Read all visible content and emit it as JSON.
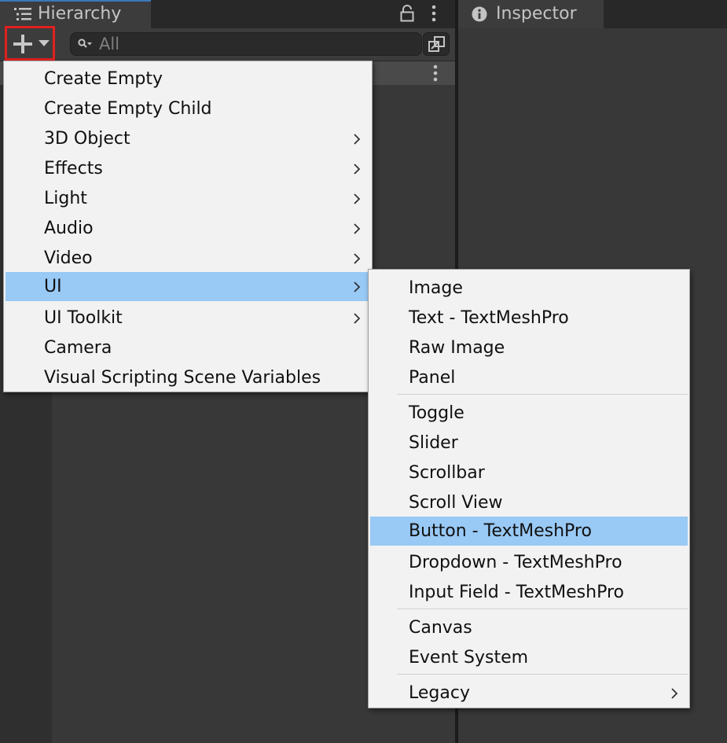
{
  "hierarchy": {
    "tab_label": "Hierarchy",
    "search_placeholder": "All"
  },
  "inspector": {
    "tab_label": "Inspector"
  },
  "create_menu": {
    "items": [
      {
        "label": "Create Empty",
        "submenu": false
      },
      {
        "label": "Create Empty Child",
        "submenu": false
      },
      {
        "label": "3D Object",
        "submenu": true
      },
      {
        "label": "Effects",
        "submenu": true
      },
      {
        "label": "Light",
        "submenu": true
      },
      {
        "label": "Audio",
        "submenu": true
      },
      {
        "label": "Video",
        "submenu": true
      },
      {
        "label": "UI",
        "submenu": true,
        "highlighted": true
      },
      {
        "label": "UI Toolkit",
        "submenu": true
      },
      {
        "label": "Camera",
        "submenu": false
      },
      {
        "label": "Visual Scripting Scene Variables",
        "submenu": false
      }
    ]
  },
  "ui_submenu": {
    "items": [
      {
        "label": "Image"
      },
      {
        "label": "Text - TextMeshPro"
      },
      {
        "label": "Raw Image"
      },
      {
        "label": "Panel"
      },
      {
        "label": "Toggle"
      },
      {
        "label": "Slider"
      },
      {
        "label": "Scrollbar"
      },
      {
        "label": "Scroll View"
      },
      {
        "label": "Button - TextMeshPro",
        "highlighted": true
      },
      {
        "label": "Dropdown - TextMeshPro"
      },
      {
        "label": "Input Field - TextMeshPro"
      },
      {
        "label": "Canvas"
      },
      {
        "label": "Event System"
      },
      {
        "label": "Legacy",
        "submenu": true
      }
    ]
  },
  "colors": {
    "highlight": "#99c9f5",
    "menu_bg": "#f2f2f2",
    "panel_bg": "#383838",
    "tab_accent": "#3a79bb",
    "annotation_box": "#e02020"
  }
}
